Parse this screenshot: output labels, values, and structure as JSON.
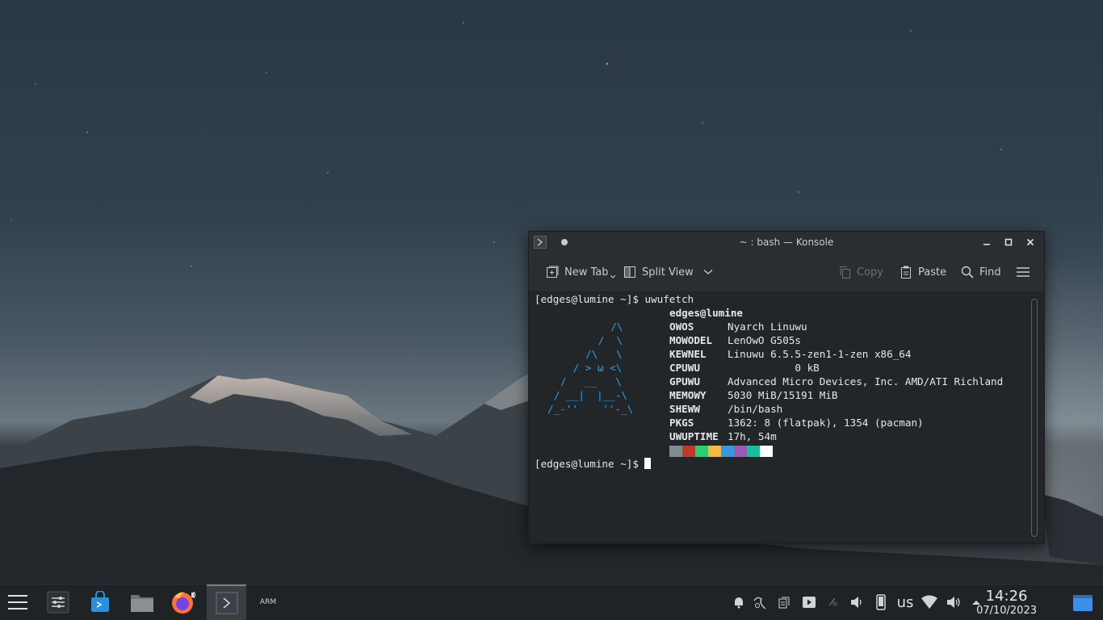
{
  "window": {
    "title": "~ : bash — Konsole"
  },
  "toolbar": {
    "new_tab": "New Tab",
    "split_view": "Split View",
    "copy": "Copy",
    "paste": "Paste",
    "find": "Find"
  },
  "terminal": {
    "prompt1": "[edges@lumine ~]$ uwufetch",
    "user_host": "edges@lumine",
    "ascii": [
      "    /\\",
      "   /  \\",
      "  /\\   \\",
      " / > ω <\\",
      "/   __   \\",
      "/ __|  |__-\\",
      "/_-''    ''-_\\"
    ],
    "info": [
      {
        "key": "OWOS",
        "value": "Nyarch Linuwu"
      },
      {
        "key": "MOWODEL",
        "value": "LenOwO G505s"
      },
      {
        "key": "KEWNEL",
        "value": "Linuwu 6.5.5-zen1-1-zen x86_64"
      },
      {
        "key": "CPUWU",
        "value": "           0 kB"
      },
      {
        "key": "GPUWU",
        "value": "Advanced Micro Devices, Inc. AMD/ATI Richland"
      },
      {
        "key": "MEMOWY",
        "value": "5030 MiB/15191 MiB"
      },
      {
        "key": "SHEWW",
        "value": "/bin/bash"
      },
      {
        "key": "PKGS",
        "value": "1362: 8 (flatpak), 1354 (pacman)"
      },
      {
        "key": "UWUPTIME",
        "value": "17h, 54m"
      }
    ],
    "palette": [
      "#7f8c8d",
      "#c0392b",
      "#2ecc71",
      "#f4b942",
      "#3498db",
      "#9b59b6",
      "#1abc9c",
      "#ffffff"
    ],
    "prompt2": "[edges@lumine ~]$ "
  },
  "taskbar": {
    "tray_keyboard": "us",
    "arm_label": "ARM",
    "time": "14:26",
    "date": "07/10/2023"
  }
}
